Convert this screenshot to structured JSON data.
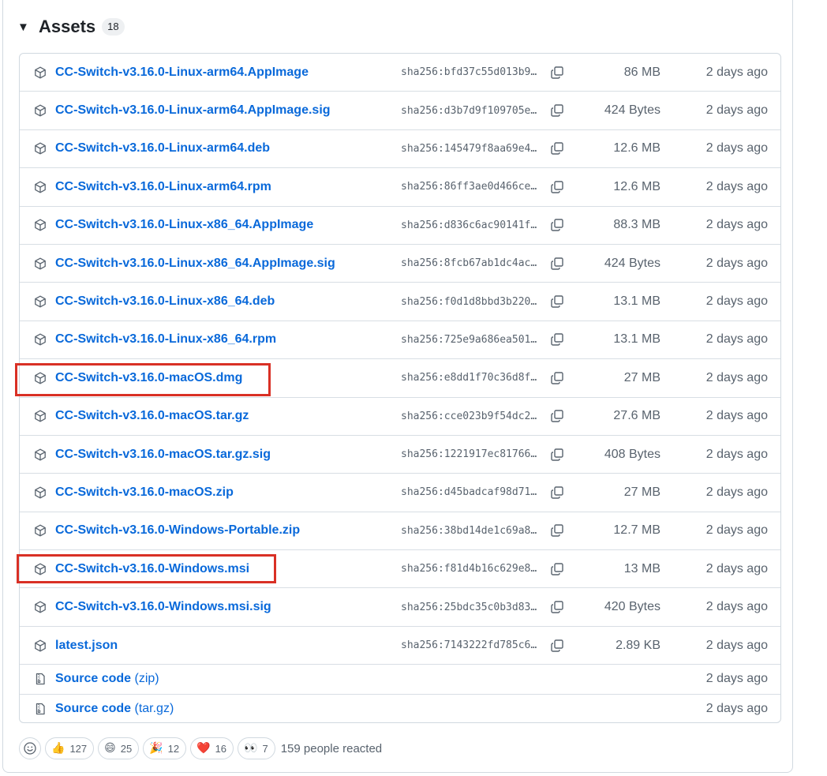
{
  "assets": {
    "title": "Assets",
    "count": "18",
    "items": [
      {
        "name": "CC-Switch-v3.16.0-Linux-arm64.AppImage",
        "digest": "sha256:bfd37c55d013b9…",
        "size": "86 MB",
        "date": "2 days ago"
      },
      {
        "name": "CC-Switch-v3.16.0-Linux-arm64.AppImage.sig",
        "digest": "sha256:d3b7d9f109705e…",
        "size": "424 Bytes",
        "date": "2 days ago"
      },
      {
        "name": "CC-Switch-v3.16.0-Linux-arm64.deb",
        "digest": "sha256:145479f8aa69e4…",
        "size": "12.6 MB",
        "date": "2 days ago"
      },
      {
        "name": "CC-Switch-v3.16.0-Linux-arm64.rpm",
        "digest": "sha256:86ff3ae0d466ce…",
        "size": "12.6 MB",
        "date": "2 days ago"
      },
      {
        "name": "CC-Switch-v3.16.0-Linux-x86_64.AppImage",
        "digest": "sha256:d836c6ac90141f…",
        "size": "88.3 MB",
        "date": "2 days ago"
      },
      {
        "name": "CC-Switch-v3.16.0-Linux-x86_64.AppImage.sig",
        "digest": "sha256:8fcb67ab1dc4ac…",
        "size": "424 Bytes",
        "date": "2 days ago"
      },
      {
        "name": "CC-Switch-v3.16.0-Linux-x86_64.deb",
        "digest": "sha256:f0d1d8bbd3b220…",
        "size": "13.1 MB",
        "date": "2 days ago"
      },
      {
        "name": "CC-Switch-v3.16.0-Linux-x86_64.rpm",
        "digest": "sha256:725e9a686ea501…",
        "size": "13.1 MB",
        "date": "2 days ago"
      },
      {
        "name": "CC-Switch-v3.16.0-macOS.dmg",
        "digest": "sha256:e8dd1f70c36d8f…",
        "size": "27 MB",
        "date": "2 days ago"
      },
      {
        "name": "CC-Switch-v3.16.0-macOS.tar.gz",
        "digest": "sha256:cce023b9f54dc2…",
        "size": "27.6 MB",
        "date": "2 days ago"
      },
      {
        "name": "CC-Switch-v3.16.0-macOS.tar.gz.sig",
        "digest": "sha256:1221917ec81766…",
        "size": "408 Bytes",
        "date": "2 days ago"
      },
      {
        "name": "CC-Switch-v3.16.0-macOS.zip",
        "digest": "sha256:d45badcaf98d71…",
        "size": "27 MB",
        "date": "2 days ago"
      },
      {
        "name": "CC-Switch-v3.16.0-Windows-Portable.zip",
        "digest": "sha256:38bd14de1c69a8…",
        "size": "12.7 MB",
        "date": "2 days ago"
      },
      {
        "name": "CC-Switch-v3.16.0-Windows.msi",
        "digest": "sha256:f81d4b16c629e8…",
        "size": "13 MB",
        "date": "2 days ago"
      },
      {
        "name": "CC-Switch-v3.16.0-Windows.msi.sig",
        "digest": "sha256:25bdc35c0b3d83…",
        "size": "420 Bytes",
        "date": "2 days ago"
      },
      {
        "name": "latest.json",
        "digest": "sha256:7143222fd785c6…",
        "size": "2.89 KB",
        "date": "2 days ago"
      }
    ],
    "source": [
      {
        "name": "Source code",
        "suffix": "(zip)",
        "date": "2 days ago"
      },
      {
        "name": "Source code",
        "suffix": "(tar.gz)",
        "date": "2 days ago"
      }
    ]
  },
  "reactions": {
    "items": [
      {
        "emoji": "👍",
        "count": "127"
      },
      {
        "emoji": "😄",
        "count": "25"
      },
      {
        "emoji": "🎉",
        "count": "12"
      },
      {
        "emoji": "❤️",
        "count": "16"
      },
      {
        "emoji": "👀",
        "count": "7"
      }
    ],
    "summary": "159 people reacted"
  },
  "colors": {
    "link": "#0969da",
    "muted": "#59636e",
    "highlight": "#d93025"
  }
}
